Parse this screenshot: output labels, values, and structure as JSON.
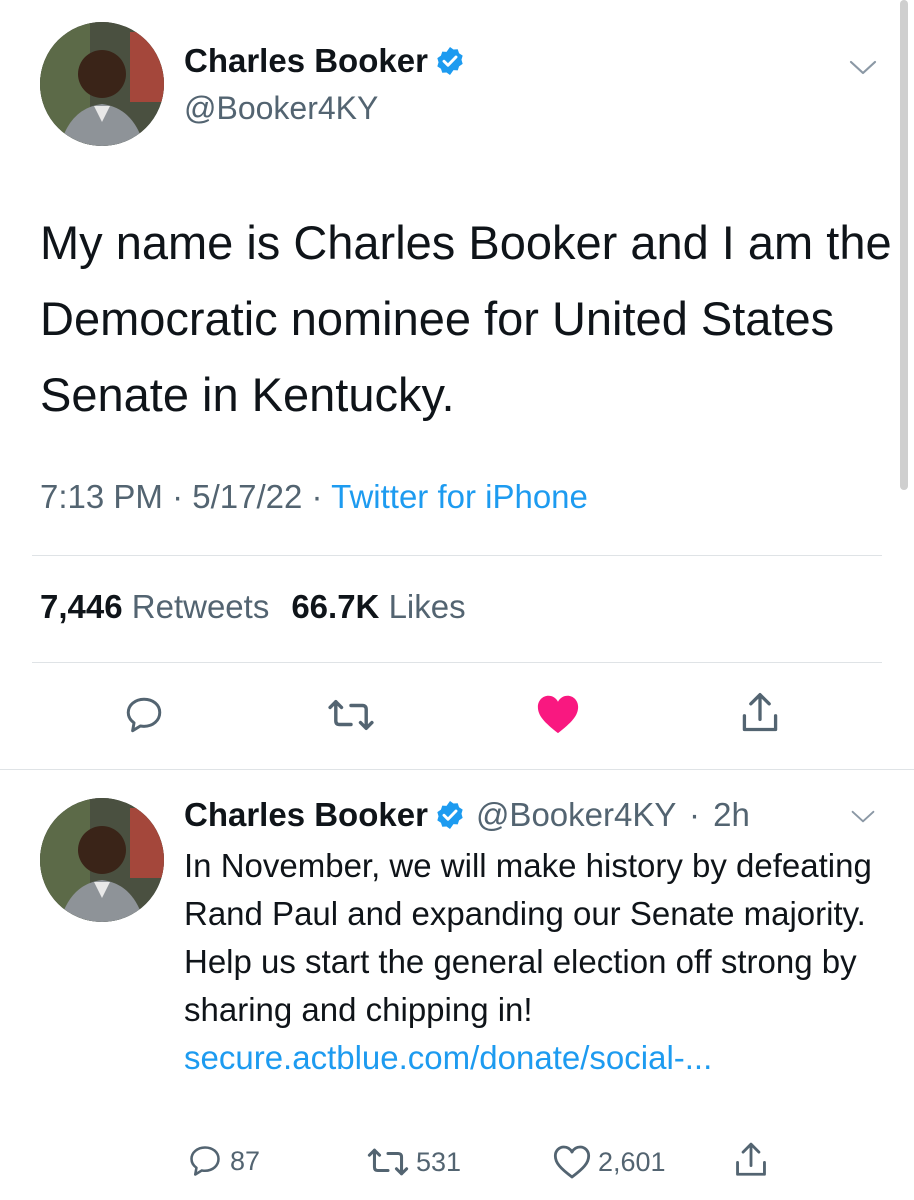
{
  "main_tweet": {
    "author_name": "Charles Booker",
    "author_handle": "@Booker4KY",
    "text": "My name is Charles Booker and I am the Democratic nominee for United States Senate in Kentucky.",
    "time": "7:13 PM",
    "date": "5/17/22",
    "separator": "·",
    "source": "Twitter for iPhone",
    "retweets_count": "7,446",
    "retweets_label": "Retweets",
    "likes_count": "66.7K",
    "likes_label": "Likes",
    "liked": true
  },
  "reply_tweet": {
    "author_name": "Charles Booker",
    "author_handle": "@Booker4KY",
    "separator": "·",
    "age": "2h",
    "text": "In November, we will make history by defeating Rand Paul and expanding our Senate majority. Help us start the general election off strong by sharing and chipping in! ",
    "link": "secure.actblue.com/donate/social-...",
    "reply_count": "87",
    "retweet_count": "531",
    "like_count": "2,601"
  },
  "icons": {
    "verified": "verified-badge-icon",
    "more": "chevron-down-icon",
    "reply": "speech-bubble-icon",
    "retweet": "retweet-arrows-icon",
    "like": "heart-icon",
    "share": "share-upload-icon"
  },
  "colors": {
    "accent": "#1d9bf0",
    "like": "#f91880",
    "text": "#0f1419",
    "secondary": "#536471"
  }
}
